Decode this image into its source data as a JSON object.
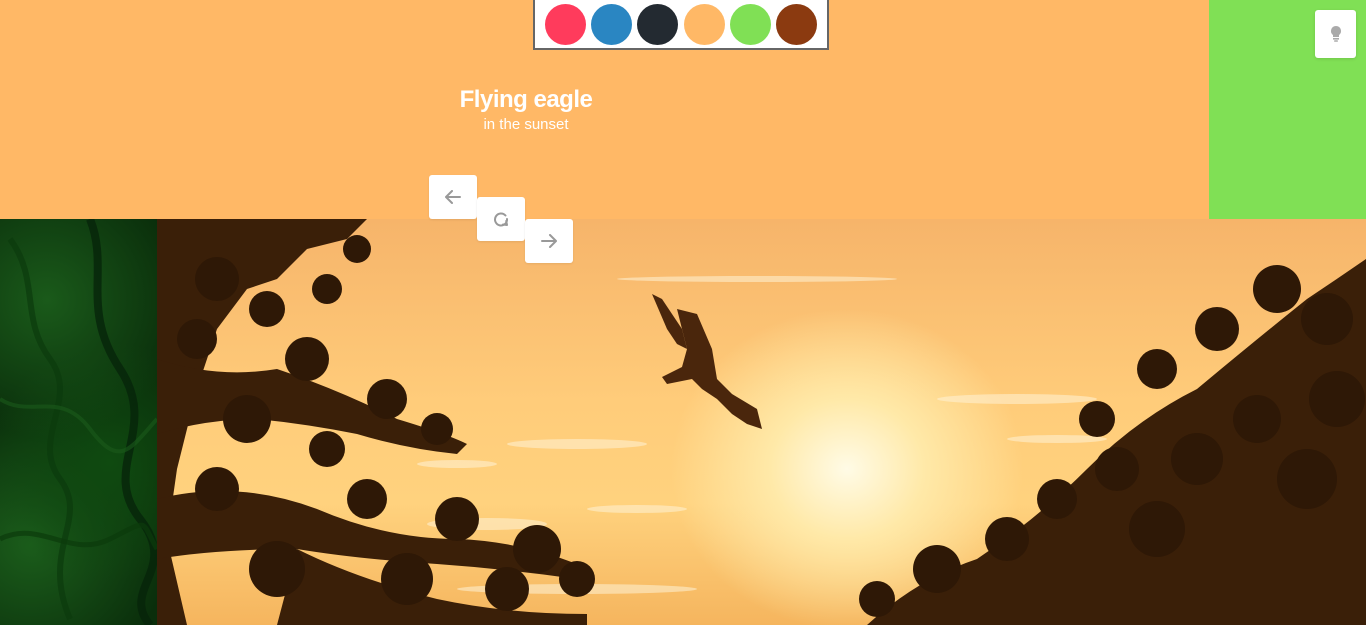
{
  "palette": {
    "swatches": [
      {
        "name": "red",
        "color": "#FF3B5C"
      },
      {
        "name": "blue",
        "color": "#2A86C2"
      },
      {
        "name": "dark",
        "color": "#232A31"
      },
      {
        "name": "orange",
        "color": "#FFB866"
      },
      {
        "name": "green",
        "color": "#80E055"
      },
      {
        "name": "brown",
        "color": "#8B3A10"
      }
    ]
  },
  "slide": {
    "title": "Flying eagle",
    "subtitle": "in the sunset"
  },
  "controls": {
    "prev_icon": "arrow-left-icon",
    "reload_icon": "reload-icon",
    "next_icon": "arrow-right-icon",
    "hint_icon": "lightbulb-icon"
  },
  "colors": {
    "background": "#FFB866",
    "side_panel": "#80E055",
    "left_texture": "#0A2E0B"
  }
}
